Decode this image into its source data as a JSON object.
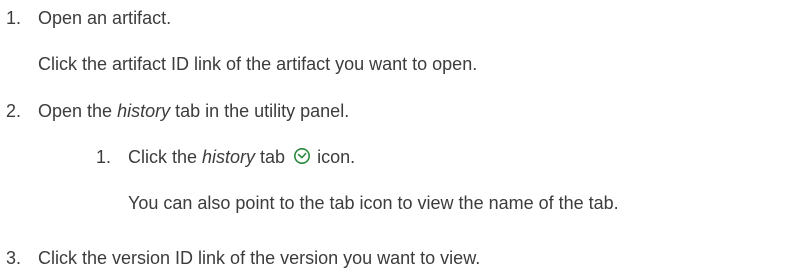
{
  "steps": [
    {
      "number": "1.",
      "text": "Open an artifact.",
      "detail": "Click the artifact ID link of the artifact you want to open."
    },
    {
      "number": "2.",
      "text_before": "Open the ",
      "text_emphasis": "history",
      "text_after": " tab in the utility panel.",
      "substeps": [
        {
          "number": "1.",
          "text_before": "Click the ",
          "text_emphasis": "history",
          "text_middle": " tab ",
          "icon": "clock-icon",
          "text_after": " icon.",
          "detail": "You can also point to the tab icon to view the name of the tab."
        }
      ]
    },
    {
      "number": "3.",
      "text": "Click the version ID link of the version you want to view."
    }
  ],
  "icon_color": "#2b8a3e"
}
